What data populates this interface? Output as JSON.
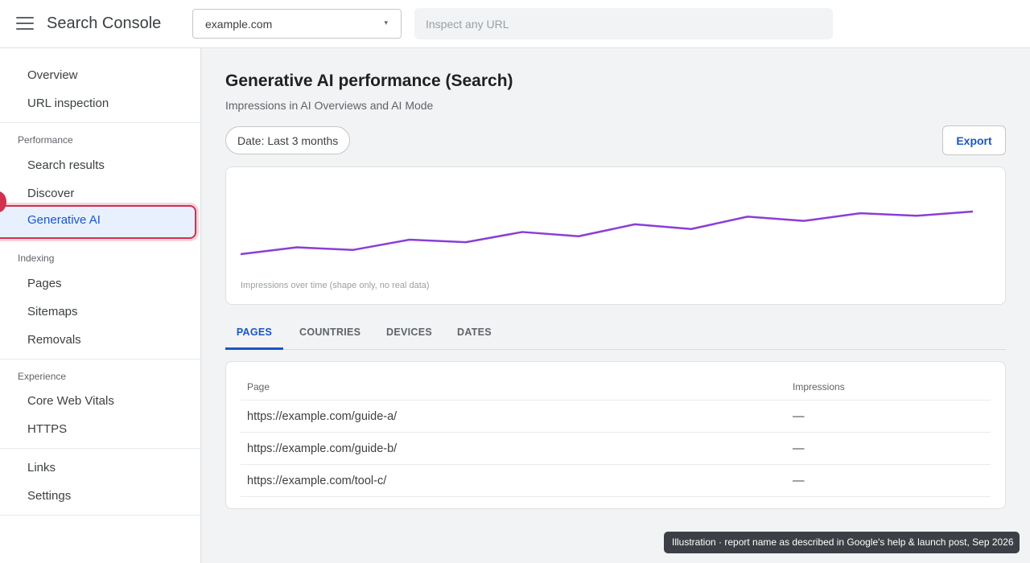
{
  "header": {
    "app_title": "Search Console",
    "menu_icon": "hamburger-menu-icon",
    "property_value": "example.com",
    "property_caret": "▾",
    "inspect_placeholder": "Inspect any URL"
  },
  "sidebar": {
    "top_items": [
      "Overview",
      "URL inspection"
    ],
    "performance": {
      "heading": "Performance",
      "items": [
        "Search results",
        "Discover",
        "Generative AI"
      ]
    },
    "indexing": {
      "heading": "Indexing",
      "items": [
        "Pages",
        "Sitemaps",
        "Removals"
      ]
    },
    "experience": {
      "heading": "Experience",
      "items": [
        "Core Web Vitals",
        "HTTPS"
      ]
    },
    "bottom_items": [
      "Links",
      "Settings"
    ],
    "active_item": "Generative AI",
    "highlight_color": "#d32f4f"
  },
  "main": {
    "title": "Generative AI performance (Search)",
    "subtitle": "Impressions in AI Overviews and AI Mode",
    "date_chip": "Date: Last 3 months",
    "export_label": "Export",
    "chart_caption": "Impressions over time (shape only, no real data)",
    "chart_line_color": "#8a3ed6",
    "chart_trend": [
      0,
      0.16,
      0.1,
      0.34,
      0.28,
      0.52,
      0.42,
      0.7,
      0.59,
      0.88,
      0.78,
      0.96,
      0.9,
      1.0
    ],
    "tabs": [
      "PAGES",
      "COUNTRIES",
      "DEVICES",
      "DATES"
    ],
    "active_tab": "PAGES",
    "table": {
      "headers": [
        "Page",
        "Impressions"
      ],
      "rows": [
        [
          "https://example.com/guide-a/",
          "—"
        ],
        [
          "https://example.com/guide-b/",
          "—"
        ],
        [
          "https://example.com/tool-c/",
          "—"
        ]
      ]
    }
  },
  "footnote": "Illustration · report name as described in Google's help & launch post, Sep 2026",
  "colors": {
    "accent": "#1a56c4",
    "active_bg": "#e8f0fe"
  }
}
